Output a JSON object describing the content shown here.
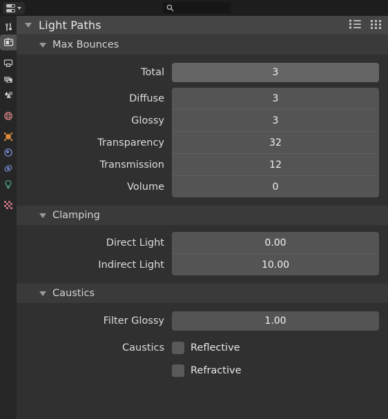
{
  "topbar": {
    "editor_type_icon": "editor-type-selector-icon",
    "chevron_icon": "chevron-down-icon",
    "search": {
      "icon": "search-icon",
      "value": "",
      "placeholder": ""
    }
  },
  "tabs": [
    {
      "name": "tool",
      "icon": "tool-icon",
      "active": false
    },
    {
      "name": "render",
      "icon": "camera-back-icon",
      "active": true
    },
    {
      "name": "output",
      "icon": "printer-icon",
      "active": false
    },
    {
      "name": "view-layer",
      "icon": "images-icon",
      "active": false
    },
    {
      "name": "scene",
      "icon": "scene-cone-icon",
      "active": false
    },
    {
      "name": "world",
      "icon": "world-globe-icon",
      "active": false
    },
    {
      "name": "object",
      "icon": "object-square-icon",
      "active": false
    },
    {
      "name": "modifiers",
      "icon": "physics-orbit-icon",
      "active": false
    },
    {
      "name": "particles",
      "icon": "particles-icon",
      "active": false
    },
    {
      "name": "object-data",
      "icon": "light-bulb-icon",
      "active": false
    },
    {
      "name": "material",
      "icon": "checker-icon",
      "active": false
    }
  ],
  "panel": {
    "title": "Light Paths",
    "disclosure_icon": "triangle-down-icon",
    "header_icons": [
      {
        "name": "list-view-icon"
      },
      {
        "name": "grid-view-icon"
      }
    ],
    "sections": [
      {
        "title": "Max Bounces",
        "single": {
          "label": "Total",
          "value": "3",
          "highlighted": true
        },
        "group": [
          {
            "label": "Diffuse",
            "value": "3"
          },
          {
            "label": "Glossy",
            "value": "3"
          },
          {
            "label": "Transparency",
            "value": "32"
          },
          {
            "label": "Transmission",
            "value": "12"
          },
          {
            "label": "Volume",
            "value": "0"
          }
        ]
      },
      {
        "title": "Clamping",
        "group": [
          {
            "label": "Direct Light",
            "value": "0.00"
          },
          {
            "label": "Indirect Light",
            "value": "10.00"
          }
        ]
      },
      {
        "title": "Caustics",
        "single": {
          "label": "Filter Glossy",
          "value": "1.00"
        },
        "checkbox_label": "Caustics",
        "checkboxes": [
          {
            "label": "Reflective",
            "checked": false
          },
          {
            "label": "Refractive",
            "checked": false
          }
        ]
      }
    ]
  },
  "colors": {
    "window_bg": "#1d1d1d",
    "panel_bg": "#303030",
    "section_header_bg": "#3a3a3a",
    "title_bg": "#454545",
    "field_bg": "#545454",
    "field_highlight_bg": "#656565",
    "tabstrip_bg": "#262626",
    "text": "#e8e8e8"
  }
}
